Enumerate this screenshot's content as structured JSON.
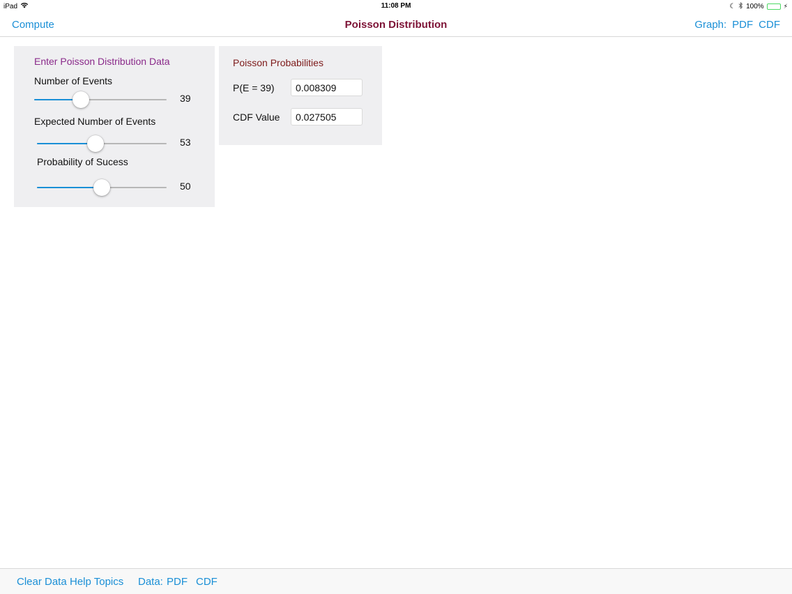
{
  "status_bar": {
    "device": "iPad",
    "time": "11:08 PM",
    "battery_text": "100%"
  },
  "nav": {
    "left_button": "Compute",
    "title": "Poisson Distribution",
    "graph_label": "Graph:",
    "graph_pdf": "PDF",
    "graph_cdf": "CDF"
  },
  "input_panel": {
    "heading": "Enter Poisson Distribution Data",
    "sliders": [
      {
        "label": "Number of Events",
        "value": "39",
        "fraction": 0.35
      },
      {
        "label": "Expected Number of Events",
        "value": "53",
        "fraction": 0.45
      },
      {
        "label": "Probability of Sucess",
        "value": "50",
        "fraction": 0.5
      }
    ]
  },
  "output_panel": {
    "heading": "Poisson Probabilities",
    "pe_label": "P(E = 39)",
    "pe_value": "0.008309",
    "cdf_label": "CDF Value",
    "cdf_value": "0.027505"
  },
  "toolbar": {
    "clear_data": "Clear Data",
    "help_topics": "Help Topics",
    "data_label": "Data:",
    "data_pdf": "PDF",
    "data_cdf": "CDF"
  },
  "colors": {
    "accent": "#1a8fd6",
    "title": "#7d1336",
    "heading_purple": "#8a2a8a",
    "heading_maroon": "#7d1a1a",
    "panel_bg": "#efeff1"
  },
  "icons": {
    "wifi": "wifi-icon",
    "moon": "moon-icon",
    "bluetooth": "bluetooth-icon",
    "battery": "battery-icon"
  }
}
